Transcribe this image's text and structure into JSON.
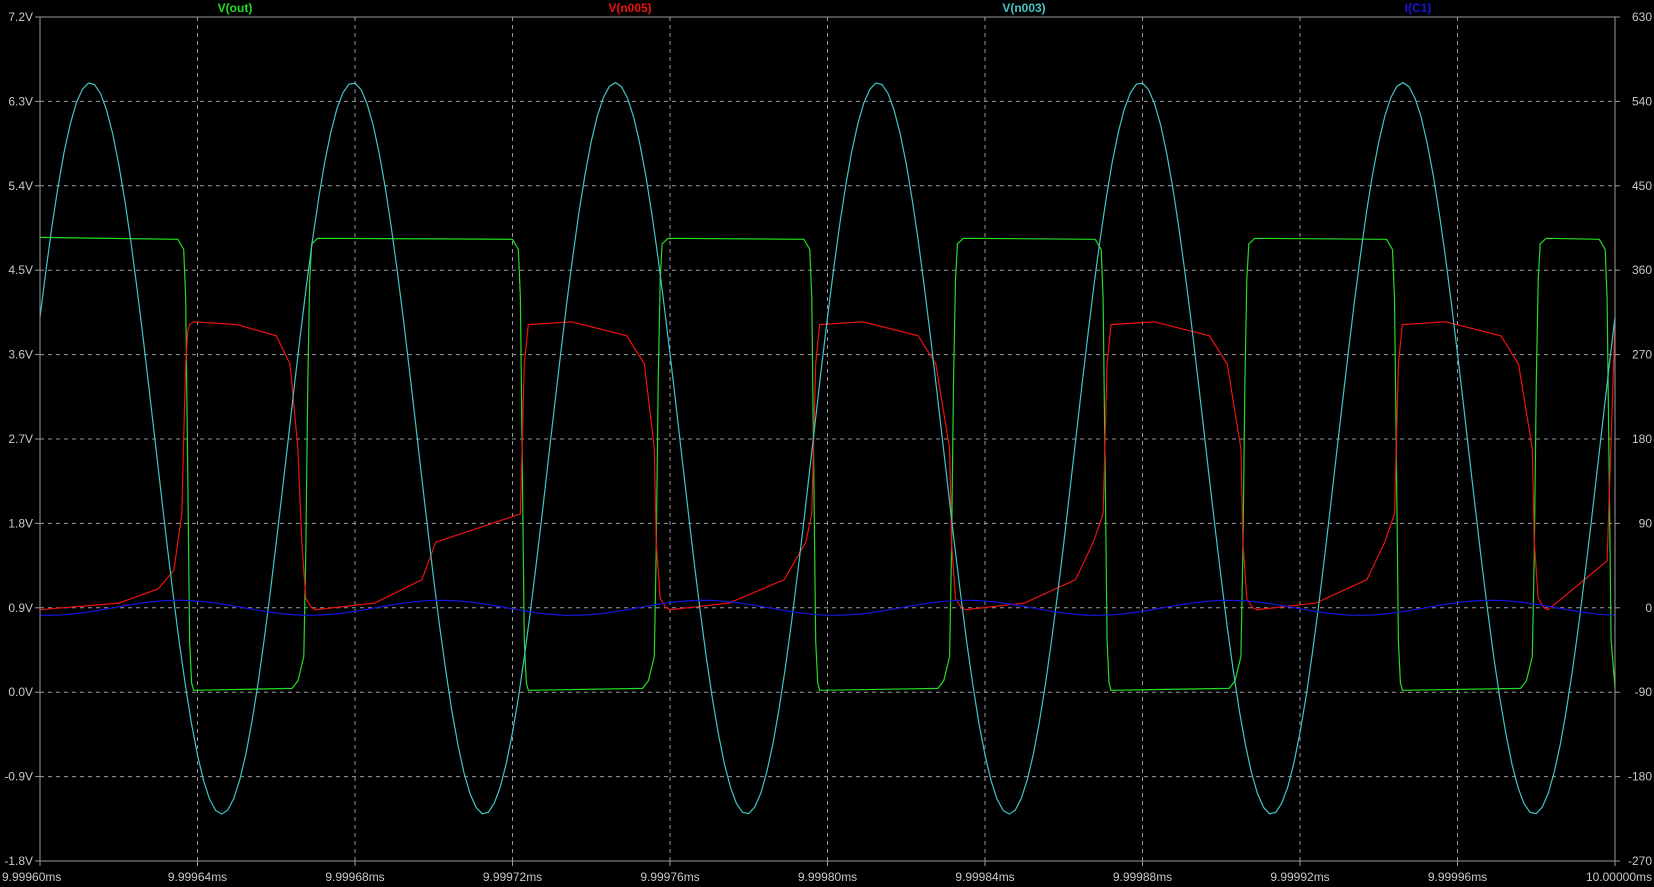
{
  "chart_data": {
    "type": "line",
    "title": "",
    "background": "#000000",
    "grid": true,
    "grid_color": "#9a9a9a",
    "axis_color": "#9a9a9a",
    "x_axis": {
      "label": "",
      "min": 9.9996,
      "max": 10.0,
      "ticks": [
        9.9996,
        9.99964,
        9.99968,
        9.99972,
        9.99976,
        9.9998,
        9.99984,
        9.99988,
        9.99992,
        9.99996,
        10.0
      ],
      "tick_labels": [
        "9.99960ms",
        "9.99964ms",
        "9.99968ms",
        "9.99972ms",
        "9.99976ms",
        "9.99980ms",
        "9.99984ms",
        "9.99988ms",
        "9.99992ms",
        "9.99996ms",
        "10.00000ms"
      ]
    },
    "y_left": {
      "label": "",
      "min": -1.8,
      "max": 7.2,
      "ticks": [
        7.2,
        6.3,
        5.4,
        4.5,
        3.6,
        2.7,
        1.8,
        0.9,
        0.0,
        -0.9,
        -1.8
      ],
      "tick_labels": [
        "7.2V",
        "6.3V",
        "5.4V",
        "4.5V",
        "3.6V",
        "2.7V",
        "1.8V",
        "0.9V",
        "0.0V",
        "-0.9V",
        "-1.8V"
      ]
    },
    "y_right": {
      "label": "",
      "min": -270,
      "max": 630,
      "ticks": [
        630,
        540,
        450,
        360,
        270,
        180,
        90,
        0,
        -90,
        -180,
        -270
      ],
      "tick_labels": [
        "630",
        "540",
        "450",
        "360",
        "270",
        "180",
        "90",
        "0",
        "-90",
        "-180",
        "-270"
      ]
    },
    "legend": [
      "V(out)",
      "V(n005)",
      "V(n003)",
      "I(C1)"
    ],
    "series": [
      {
        "name": "V(out)",
        "color": "#22dd22",
        "axis": "left",
        "x": [
          9.9996,
          9.999635,
          9.9996365,
          9.999637,
          9.9996375,
          9.999638,
          9.9996385,
          9.999639,
          9.999664,
          9.9996655,
          9.999667,
          9.9996675,
          9.999668,
          9.9996685,
          9.999669,
          9.9996705,
          9.99972,
          9.9997215,
          9.999722,
          9.9997225,
          9.999723,
          9.9997235,
          9.999724,
          9.999753,
          9.9997545,
          9.999756,
          9.9997565,
          9.999757,
          9.9997575,
          9.999758,
          9.9997595,
          9.999794,
          9.9997955,
          9.999796,
          9.9997965,
          9.999797,
          9.9997975,
          9.999798,
          9.999828,
          9.9998295,
          9.999831,
          9.9998315,
          9.999832,
          9.9998325,
          9.999833,
          9.9998345,
          9.999868,
          9.9998695,
          9.99987,
          9.9998705,
          9.999871,
          9.9998715,
          9.999872,
          9.999902,
          9.9999035,
          9.999905,
          9.9999055,
          9.999906,
          9.9999065,
          9.999907,
          9.9999085,
          9.999942,
          9.9999435,
          9.999944,
          9.9999445,
          9.999945,
          9.9999455,
          9.999946,
          9.999976,
          9.9999775,
          9.999979,
          9.9999795,
          9.99998,
          9.9999805,
          9.999981,
          9.9999825,
          9.999996,
          9.9999975,
          9.999998,
          9.9999985,
          9.999999,
          10.0
        ],
        "y": [
          4.85,
          4.83,
          4.72,
          4.2,
          2.4,
          0.55,
          0.1,
          0.02,
          0.04,
          0.12,
          0.38,
          1.5,
          3.3,
          4.4,
          4.78,
          4.84,
          4.83,
          4.72,
          4.2,
          2.4,
          0.55,
          0.1,
          0.02,
          0.04,
          0.12,
          0.38,
          1.5,
          3.3,
          4.4,
          4.78,
          4.84,
          4.83,
          4.72,
          4.2,
          2.4,
          0.55,
          0.1,
          0.02,
          0.04,
          0.12,
          0.38,
          1.5,
          3.3,
          4.4,
          4.78,
          4.84,
          4.83,
          4.72,
          4.2,
          2.4,
          0.55,
          0.1,
          0.02,
          0.04,
          0.12,
          0.38,
          1.5,
          3.3,
          4.4,
          4.78,
          4.84,
          4.83,
          4.72,
          4.2,
          2.4,
          0.55,
          0.1,
          0.02,
          0.04,
          0.12,
          0.38,
          1.5,
          3.3,
          4.4,
          4.78,
          4.84,
          4.83,
          4.72,
          4.2,
          2.4,
          0.55,
          0.05
        ]
      },
      {
        "name": "V(n005)",
        "color": "#ee1111",
        "axis": "left",
        "x": [
          9.9996,
          9.99962,
          9.99963,
          9.999634,
          9.999636,
          9.9996365,
          9.999637,
          9.9996375,
          9.999638,
          9.999639,
          9.99965,
          9.99966,
          9.9996635,
          9.9996655,
          9.9996665,
          9.9996675,
          9.999669,
          9.99967,
          9.999685,
          9.999697,
          9.9997005,
          9.999722,
          9.9997225,
          9.999723,
          9.999724,
          9.999735,
          9.999749,
          9.9997535,
          9.999756,
          9.9997565,
          9.9997575,
          9.999759,
          9.99976,
          9.999775,
          9.999789,
          9.9997945,
          9.999796,
          9.9997965,
          9.999797,
          9.999798,
          9.999809,
          9.999823,
          9.9998275,
          9.999831,
          9.9998315,
          9.9998325,
          9.999834,
          9.999835,
          9.99985,
          9.999863,
          9.9998675,
          9.99987,
          9.9998705,
          9.999871,
          9.999872,
          9.999883,
          9.999897,
          9.9999015,
          9.999905,
          9.9999055,
          9.9999065,
          9.999908,
          9.999909,
          9.999924,
          9.999937,
          9.9999415,
          9.999944,
          9.9999445,
          9.999945,
          9.999946,
          9.999957,
          9.999971,
          9.9999755,
          9.999979,
          9.9999795,
          9.9999805,
          9.999982,
          9.999983,
          9.999998,
          10.0
        ],
        "y": [
          0.88,
          0.95,
          1.1,
          1.3,
          1.9,
          2.7,
          3.5,
          3.85,
          3.92,
          3.95,
          3.92,
          3.8,
          3.5,
          2.6,
          1.6,
          1.0,
          0.9,
          0.88,
          0.95,
          1.2,
          1.6,
          1.9,
          2.7,
          3.5,
          3.92,
          3.95,
          3.8,
          3.5,
          2.6,
          1.6,
          1.0,
          0.9,
          0.88,
          0.95,
          1.2,
          1.6,
          1.9,
          2.7,
          3.5,
          3.92,
          3.95,
          3.8,
          3.5,
          2.6,
          1.6,
          1.0,
          0.9,
          0.88,
          0.95,
          1.2,
          1.6,
          1.9,
          2.7,
          3.5,
          3.92,
          3.95,
          3.8,
          3.5,
          2.6,
          1.6,
          1.0,
          0.9,
          0.88,
          0.95,
          1.2,
          1.6,
          1.9,
          2.7,
          3.5,
          3.92,
          3.95,
          3.8,
          3.5,
          2.6,
          1.6,
          1.0,
          0.9,
          0.88,
          1.4,
          3.95
        ]
      },
      {
        "name": "V(n003)",
        "color": "#44c4c4",
        "axis": "left",
        "period": 6.66667e-05,
        "phase_x": 9.9996,
        "phase_deg": 21,
        "mean": 2.6,
        "amplitude": 3.9,
        "sample_count": 260
      },
      {
        "name": "I(C1)",
        "color": "#1515dd",
        "axis": "right",
        "period": 6.66667e-05,
        "phase_x": 9.9996,
        "phase_deg": 260,
        "mean": 0,
        "amplitude": 8,
        "sample_count": 200
      }
    ]
  }
}
